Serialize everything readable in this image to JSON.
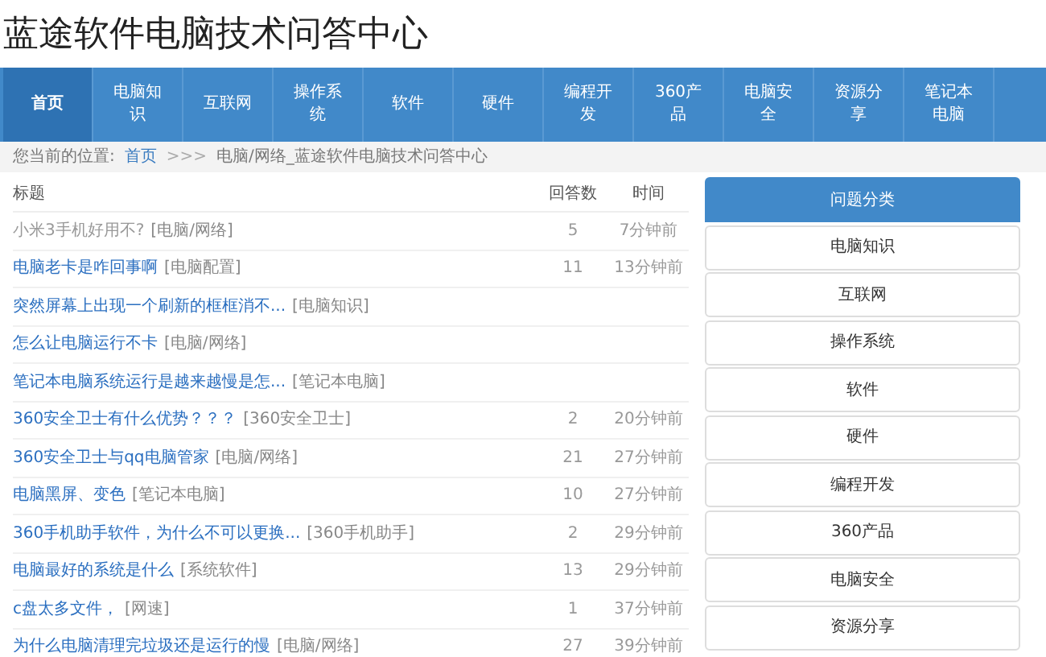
{
  "site_title": "蓝途软件电脑技术问答中心",
  "nav": [
    {
      "label": "首页",
      "selected": true
    },
    {
      "label": "电脑知识",
      "selected": false
    },
    {
      "label": "互联网",
      "selected": false
    },
    {
      "label": "操作系统",
      "selected": false
    },
    {
      "label": "软件",
      "selected": false
    },
    {
      "label": "硬件",
      "selected": false
    },
    {
      "label": "编程开发",
      "selected": false
    },
    {
      "label": "360产品",
      "selected": false
    },
    {
      "label": "电脑安全",
      "selected": false
    },
    {
      "label": "资源分享",
      "selected": false
    },
    {
      "label": "笔记本电脑",
      "selected": false
    }
  ],
  "breadcrumb": {
    "prefix": "您当前的位置:",
    "home": "首页",
    "separator": ">>>",
    "current": "电脑/网络_蓝途软件电脑技术问答中心"
  },
  "table": {
    "columns": [
      "标题",
      "回答数",
      "时间"
    ],
    "rows": [
      {
        "title": "小米3手机好用不?",
        "category": "[电脑/网络]",
        "answers": "5",
        "time": "7分钟前",
        "visited": true
      },
      {
        "title": "电脑老卡是咋回事啊",
        "category": "[电脑配置]",
        "answers": "11",
        "time": "13分钟前",
        "visited": false
      },
      {
        "title": "突然屏幕上出现一个刷新的框框消不...",
        "category": "[电脑知识]",
        "visited": false
      },
      {
        "title": "怎么让电脑运行不卡",
        "category": "[电脑/网络]",
        "visited": false
      },
      {
        "title": "笔记本电脑系统运行是越来越慢是怎...",
        "category": "[笔记本电脑]",
        "visited": false
      },
      {
        "title": "360安全卫士有什么优势？？？",
        "category": "[360安全卫士]",
        "answers": "2",
        "time": "20分钟前",
        "visited": false
      },
      {
        "title": "360安全卫士与qq电脑管家",
        "category": "[电脑/网络]",
        "answers": "21",
        "time": "27分钟前",
        "visited": false
      },
      {
        "title": "电脑黑屏、变色",
        "category": "[笔记本电脑]",
        "answers": "10",
        "time": "27分钟前",
        "visited": false
      },
      {
        "title": "360手机助手软件，为什么不可以更换...",
        "category": "[360手机助手]",
        "answers": "2",
        "time": "29分钟前",
        "visited": false
      },
      {
        "title": "电脑最好的系统是什么",
        "category": "[系统软件]",
        "answers": "13",
        "time": "29分钟前",
        "visited": false
      },
      {
        "title": "c盘太多文件，",
        "category": "[网速]",
        "answers": "1",
        "time": "37分钟前",
        "visited": false
      },
      {
        "title": "为什么电脑清理完垃圾还是运行的慢",
        "category": "[电脑/网络]",
        "answers": "27",
        "time": "39分钟前",
        "visited": false
      }
    ]
  },
  "sidebar": {
    "title": "问题分类",
    "items": [
      "电脑知识",
      "互联网",
      "操作系统",
      "软件",
      "硬件",
      "编程开发",
      "360产品",
      "电脑安全",
      "资源分享"
    ]
  }
}
